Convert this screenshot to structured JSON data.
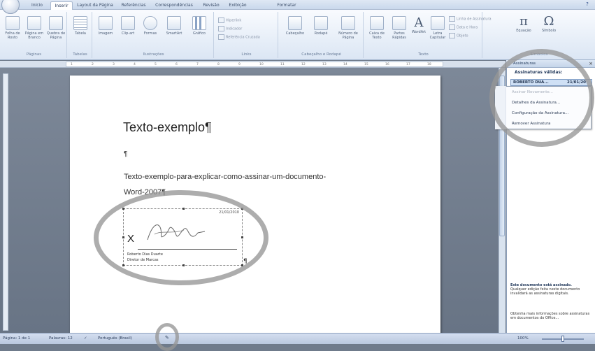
{
  "tabs": [
    "Início",
    "Inserir",
    "Layout da Página",
    "Referências",
    "Correspondências",
    "Revisão",
    "Exibição",
    "Formatar"
  ],
  "ribbon": {
    "groups": {
      "paginas": "Páginas",
      "tabelas": "Tabelas",
      "ilustracoes": "Ilustrações",
      "links": "Links",
      "cabecalho": "Cabeçalho e Rodapé",
      "texto": "Texto",
      "simbolos": "Símbolos"
    },
    "buttons": {
      "folha_rosto": "Folha de Rosto",
      "pagina_branco": "Página em Branco",
      "quebra_pagina": "Quebra de Página",
      "tabela": "Tabela",
      "imagem": "Imagem",
      "clip_art": "Clip-art",
      "formas": "Formas",
      "smartart": "SmartArt",
      "grafico": "Gráfico",
      "hiperlink": "Hiperlink",
      "indicador": "Indicador",
      "ref_cruzada": "Referência Cruzada",
      "cabecalho": "Cabeçalho",
      "rodape": "Rodapé",
      "numero_pagina": "Número de Página",
      "caixa_texto": "Caixa de Texto",
      "partes_rapidas": "Partes Rápidas",
      "wordart": "WordArt",
      "letra_capitular": "Letra Capitular",
      "linha_assinatura": "Linha de Assinatura",
      "data_hora": "Data e Hora",
      "objeto": "Objeto",
      "equacao": "Equação",
      "simbolo": "Símbolo"
    },
    "glyphs": {
      "wordart": "A",
      "equacao": "π",
      "simbolo": "Ω"
    }
  },
  "ruler_ticks": [
    "1",
    "2",
    "3",
    "4",
    "5",
    "6",
    "7",
    "8",
    "9",
    "10",
    "11",
    "12",
    "13",
    "14",
    "15",
    "16",
    "17",
    "18"
  ],
  "document": {
    "title": "Texto-exemplo¶",
    "pilcrow": "¶",
    "line1": "Texto-exemplo-para-explicar-como-assinar-um-documento-",
    "line2": "Word-2007¶",
    "signature": {
      "date": "21/01/2010",
      "x_mark": "X",
      "name": "Roberto Dias Duarte",
      "role": "Diretor de Marcas"
    },
    "end_pilcrow": "¶"
  },
  "task_pane": {
    "title": "Assinaturas",
    "close": "×",
    "valid_heading": "Assinaturas válidas:",
    "signature_item": {
      "name": "ROBERTO DUA...",
      "date": "21/01/20"
    },
    "menu": [
      "Assinar Novamente...",
      "Detalhes da Assinatura...",
      "Configuração da Assinatura...",
      "Remover Assinatura"
    ],
    "info_bold": "Este documento está assinado.",
    "info_text": "Qualquer edição feita neste documento invalidará as assinaturas digitais.",
    "info_more": "Obtenha mais informações sobre assinaturas em documentos do Office..."
  },
  "status_bar": {
    "page": "Página: 1 de 1",
    "words": "Palavras: 12",
    "language": "Português (Brasil)",
    "zoom": "100%"
  },
  "colors": {
    "highlight_ring": "#969696",
    "page": "#ffffff",
    "ribbon": "#dbe6f4"
  }
}
